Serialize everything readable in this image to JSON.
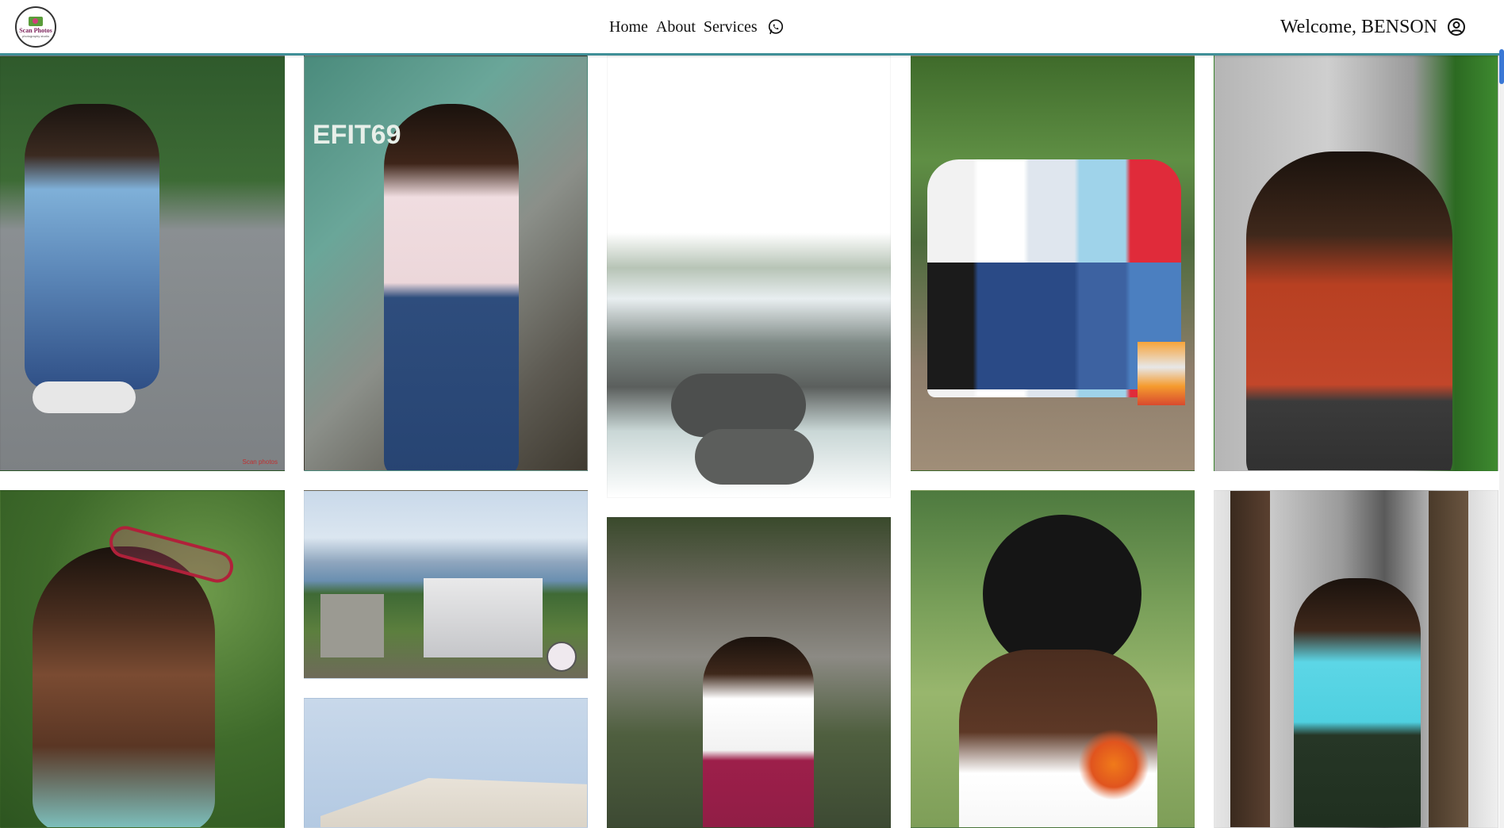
{
  "brand": {
    "logo_text": "Scan Photos",
    "logo_subtext": "photography studio"
  },
  "nav": {
    "home": "Home",
    "about": "About",
    "services": "Services",
    "whatsapp_icon": "whatsapp-icon"
  },
  "header": {
    "welcome": "Welcome, BENSON",
    "user_icon": "user-circle-icon"
  },
  "colors": {
    "accent": "#3f8f97",
    "scroll_accent": "#3a78d6"
  },
  "gallery": {
    "watermark": "Scan photos"
  }
}
